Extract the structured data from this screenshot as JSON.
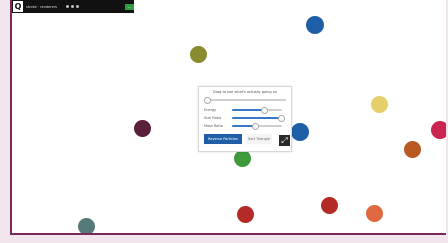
{
  "topbar": {
    "logo": "Q",
    "left_text": "stroke · renderers",
    "right_label": "..."
  },
  "panel": {
    "title": "Drag to see what's actually going on",
    "sliders": [
      {
        "label": "Energy",
        "value": 0.65
      },
      {
        "label": "Size Ratio",
        "value": 1.0
      },
      {
        "label": "Mass Ratio",
        "value": 0.45
      }
    ],
    "time_value": 0.0,
    "primary_button": "Reverse Particles",
    "secondary_button": "Sort Triangle",
    "expand_glyph": "⤢"
  },
  "colors": {
    "accent": "#1f5fa8",
    "border": "#7a2a5a"
  },
  "balls": [
    {
      "id": "ball-blue-top",
      "color": "#1f5fa8"
    },
    {
      "id": "ball-olive",
      "color": "#8a8a2e"
    },
    {
      "id": "ball-maroon",
      "color": "#5a1f3a"
    },
    {
      "id": "ball-blue-mid",
      "color": "#1f5fa8"
    },
    {
      "id": "ball-yellow",
      "color": "#e4cf6a"
    },
    {
      "id": "ball-crimson",
      "color": "#cc2450"
    },
    {
      "id": "ball-orange-brown",
      "color": "#b85a22"
    },
    {
      "id": "ball-green",
      "color": "#3f9a3c"
    },
    {
      "id": "ball-red-left",
      "color": "#b32a26"
    },
    {
      "id": "ball-red-right",
      "color": "#b32a26"
    },
    {
      "id": "ball-orange",
      "color": "#e0683e"
    },
    {
      "id": "ball-teal",
      "color": "#56797a"
    }
  ]
}
